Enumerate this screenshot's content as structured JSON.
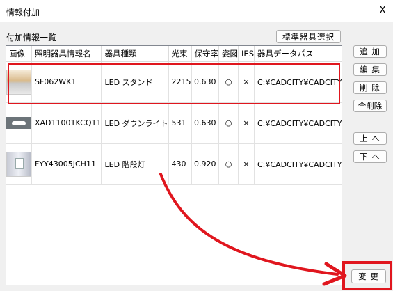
{
  "window": {
    "title": "情報付加",
    "close_glyph": "X"
  },
  "section_label": "付加情報一覧",
  "buttons": {
    "standard_select": "標準器具選択",
    "add": "追 加",
    "edit": "編 集",
    "delete": "削 除",
    "delete_all": "全削除",
    "up": "上 へ",
    "down": "下 へ",
    "change": "変 更"
  },
  "table": {
    "headers": [
      "画像",
      "照明器具情報名",
      "器具種類",
      "光束",
      "保守率",
      "姿図",
      "IES",
      "器具データパス"
    ],
    "rows": [
      {
        "thumb": "indirect-light-thumbnail",
        "name": "SF062WK1",
        "type": "LED スタンド",
        "flux": "2215",
        "maint": "0.630",
        "figure": "○",
        "ies": "×",
        "path": "C:¥CADCITY¥CADCITY電設"
      },
      {
        "thumb": "downlight-thumbnail",
        "name": "XAD11001KCQ11",
        "type": "LED ダウンライト",
        "flux": "531",
        "maint": "0.630",
        "figure": "○",
        "ies": "×",
        "path": "C:¥CADCITY¥CADCITY電設"
      },
      {
        "thumb": "wall-light-thumbnail",
        "name": "FYY43005JCH11",
        "type": "LED 階段灯",
        "flux": "430",
        "maint": "0.920",
        "figure": "○",
        "ies": "×",
        "path": "C:¥CADCITY¥CADCITY電設"
      }
    ]
  },
  "colors": {
    "annotation_red": "#e0161e"
  }
}
